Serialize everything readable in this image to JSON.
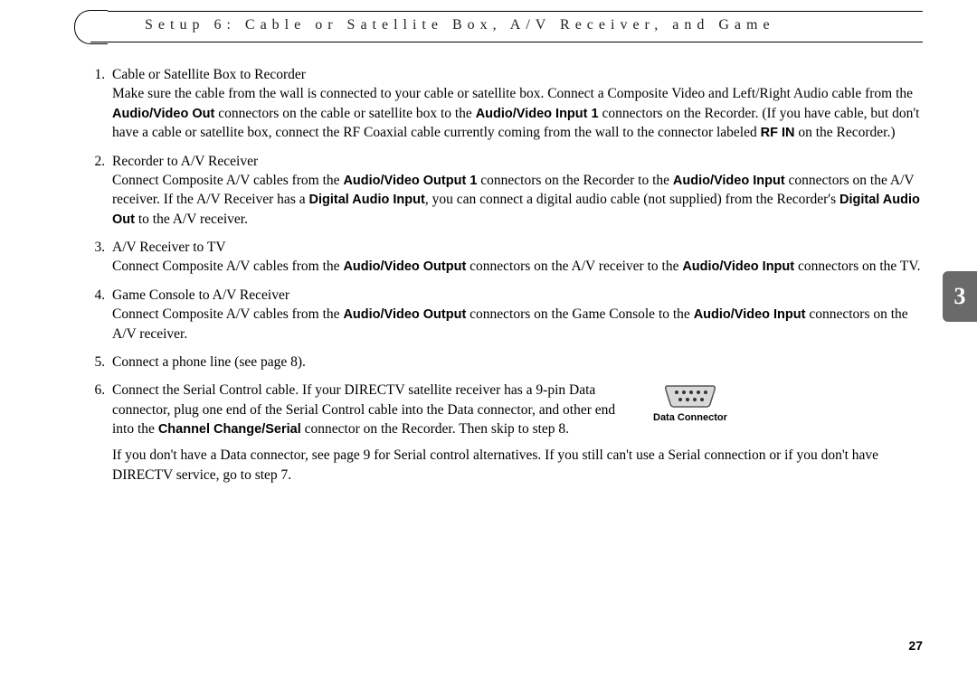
{
  "header": {
    "title": "Setup 6: Cable or Satellite Box, A/V Receiver, and Game"
  },
  "tab": {
    "number": "3"
  },
  "steps": {
    "s1": {
      "title": "Cable or Satellite Box to Recorder",
      "p1a": "Make sure the cable from the wall is connected to your cable or satellite box. Connect a Composite Video and Left/Right Audio cable from the ",
      "b1": "Audio/Video Out",
      "p1b": " connectors on the cable or satellite box to the ",
      "b2": "Audio/Video Input 1",
      "p1c": " connectors on the Recorder. (If you have cable, but don't have a cable or satellite box, connect the RF Coaxial cable currently coming from the wall to the connector labeled ",
      "b3": "RF IN",
      "p1d": " on the Recorder.)"
    },
    "s2": {
      "title": "Recorder to A/V Receiver",
      "p1a": "Connect Composite A/V cables from the ",
      "b1": "Audio/Video Output 1",
      "p1b": " connectors on the Recorder to the ",
      "b2": "Audio/Video Input",
      "p1c": " connectors on the A/V receiver. If the A/V Receiver has a ",
      "b3": "Digital Audio Input",
      "p1d": ", you can connect a digital audio cable (not supplied) from the Recorder's ",
      "b4": "Digital Audio Out",
      "p1e": " to the A/V receiver."
    },
    "s3": {
      "title": "A/V Receiver to TV",
      "p1a": "Connect Composite A/V cables from the ",
      "b1": "Audio/Video Output",
      "p1b": " connectors on the A/V receiver to the ",
      "b2": "Audio/Video Input",
      "p1c": " connectors on the TV."
    },
    "s4": {
      "title": "Game Console to A/V Receiver",
      "p1a": "Connect Composite A/V cables from the ",
      "b1": "Audio/Video Output",
      "p1b": " connectors on the Game Console to the ",
      "b2": "Audio/Video Input",
      "p1c": " connectors on the A/V receiver."
    },
    "s5": {
      "title": "Connect a phone line (see page 8)."
    },
    "s6": {
      "p1a": "Connect the Serial Control cable. If your DIRECTV satellite receiver has a 9-pin Data connector, plug one end of the Serial Control cable into the Data connector, and other end into the ",
      "b1": "Channel Change/Serial",
      "p1b": " connector on the Recorder. Then skip to step 8.",
      "p2": "If you don't have a Data connector, see page 9 for Serial control alternatives. If you still can't use a Serial connection or if you don't have DIRECTV service, go to step 7."
    }
  },
  "figure": {
    "caption": "Data Connector"
  },
  "page_number": "27"
}
